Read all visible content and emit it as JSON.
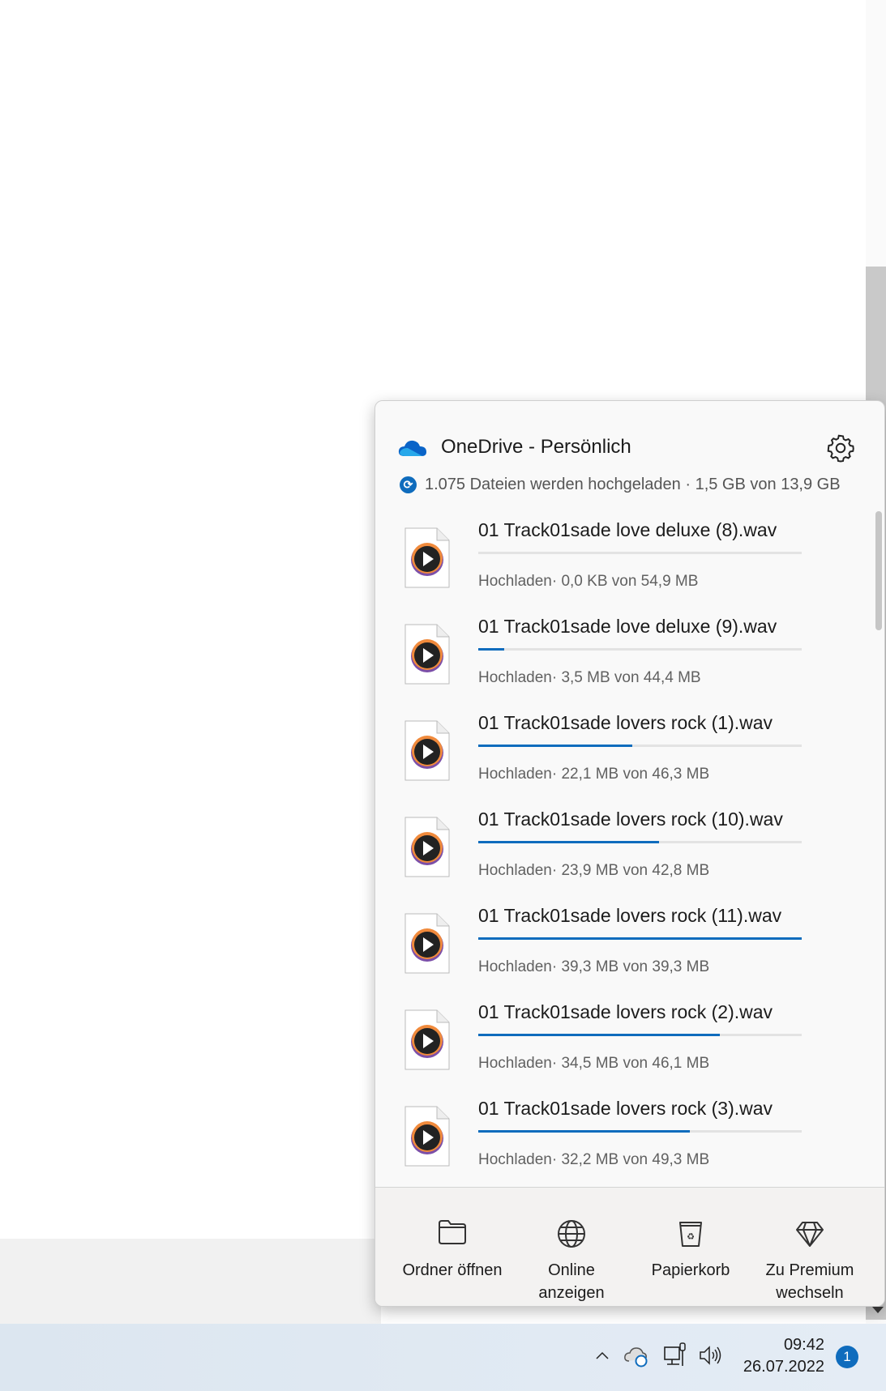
{
  "panel": {
    "title": "OneDrive - Persönlich",
    "status": "1.075 Dateien werden hochgeladen · 1,5 GB von 13,9 GB",
    "items": [
      {
        "name": "01 Track01sade love deluxe (8).wav",
        "status": "Hochladen· 0,0 KB von 54,9 MB",
        "progress": 0.0
      },
      {
        "name": "01 Track01sade love deluxe (9).wav",
        "status": "Hochladen· 3,5 MB von 44,4 MB",
        "progress": 0.079
      },
      {
        "name": "01 Track01sade lovers rock (1).wav",
        "status": "Hochladen· 22,1 MB von 46,3 MB",
        "progress": 0.477
      },
      {
        "name": "01 Track01sade lovers rock (10).wav",
        "status": "Hochladen· 23,9 MB von 42,8 MB",
        "progress": 0.558
      },
      {
        "name": "01 Track01sade lovers rock (11).wav",
        "status": "Hochladen· 39,3 MB von 39,3 MB",
        "progress": 1.0
      },
      {
        "name": "01 Track01sade lovers rock (2).wav",
        "status": "Hochladen· 34,5 MB von 46,1 MB",
        "progress": 0.748
      },
      {
        "name": "01 Track01sade lovers rock (3).wav",
        "status": "Hochladen· 32,2 MB von 49,3 MB",
        "progress": 0.653
      }
    ],
    "footer": {
      "open_folder": "Ordner öffnen",
      "view_online_1": "Online",
      "view_online_2": "anzeigen",
      "recycle_bin": "Papierkorb",
      "premium_1": "Zu Premium",
      "premium_2": "wechseln"
    }
  },
  "taskbar": {
    "time": "09:42",
    "date": "26.07.2022",
    "notifications": "1"
  },
  "colors": {
    "accent": "#0f6cbd"
  }
}
